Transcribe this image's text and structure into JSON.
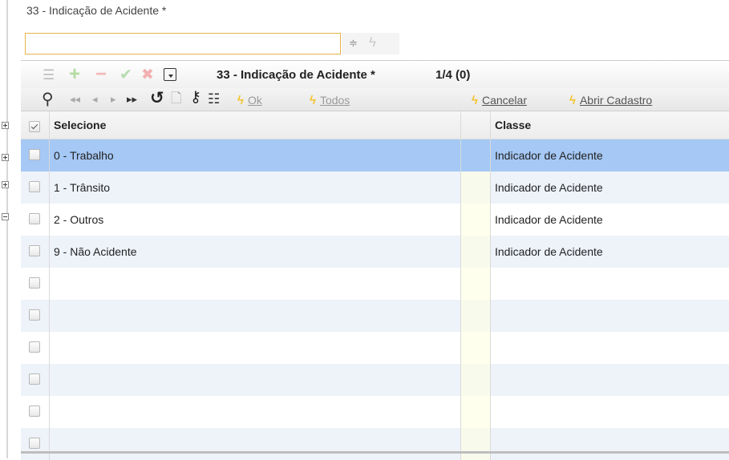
{
  "field": {
    "label": "33 - Indicação de Acidente *",
    "value": ""
  },
  "lookup": {
    "title": "33 - Indicação de Acidente *",
    "page_info": "1/4 (0)",
    "actions": {
      "ok": "Ok",
      "todos": "Todos",
      "cancelar": "Cancelar",
      "abrir_cadastro": "Abrir Cadastro"
    },
    "columns": {
      "select": "Selecione",
      "classe": "Classe"
    },
    "rows": [
      {
        "label": "0 - Trabalho",
        "classe": "Indicador de Acidente"
      },
      {
        "label": "1 - Trânsito",
        "classe": "Indicador de Acidente"
      },
      {
        "label": "2 - Outros",
        "classe": "Indicador de Acidente"
      },
      {
        "label": "9 - Não Acidente",
        "classe": "Indicador de Acidente"
      },
      {
        "label": "",
        "classe": ""
      },
      {
        "label": "",
        "classe": ""
      },
      {
        "label": "",
        "classe": ""
      },
      {
        "label": "",
        "classe": ""
      },
      {
        "label": "",
        "classe": ""
      },
      {
        "label": "",
        "classe": ""
      }
    ],
    "selected_row": 0
  },
  "icons": {
    "spin": "spin-updown-icon",
    "bolt": "lightning-bolt-icon",
    "list": "list-icon",
    "add": "plus-icon",
    "remove": "minus-icon",
    "confirm": "check-icon",
    "delete": "x-icon",
    "dropdown": "dropdown-icon",
    "search": "search-icon",
    "first": "first-page-icon",
    "prev": "prev-page-icon",
    "next": "next-page-icon",
    "last": "last-page-icon",
    "undo": "undo-icon",
    "export": "export-document-icon",
    "key": "key-icon",
    "list_edit": "list-edit-icon"
  },
  "colors": {
    "selected_row": "#a5c8f5",
    "alt_row": "#eef3fa",
    "bolt": "#f3c530",
    "focus_border": "#e8b24a"
  }
}
